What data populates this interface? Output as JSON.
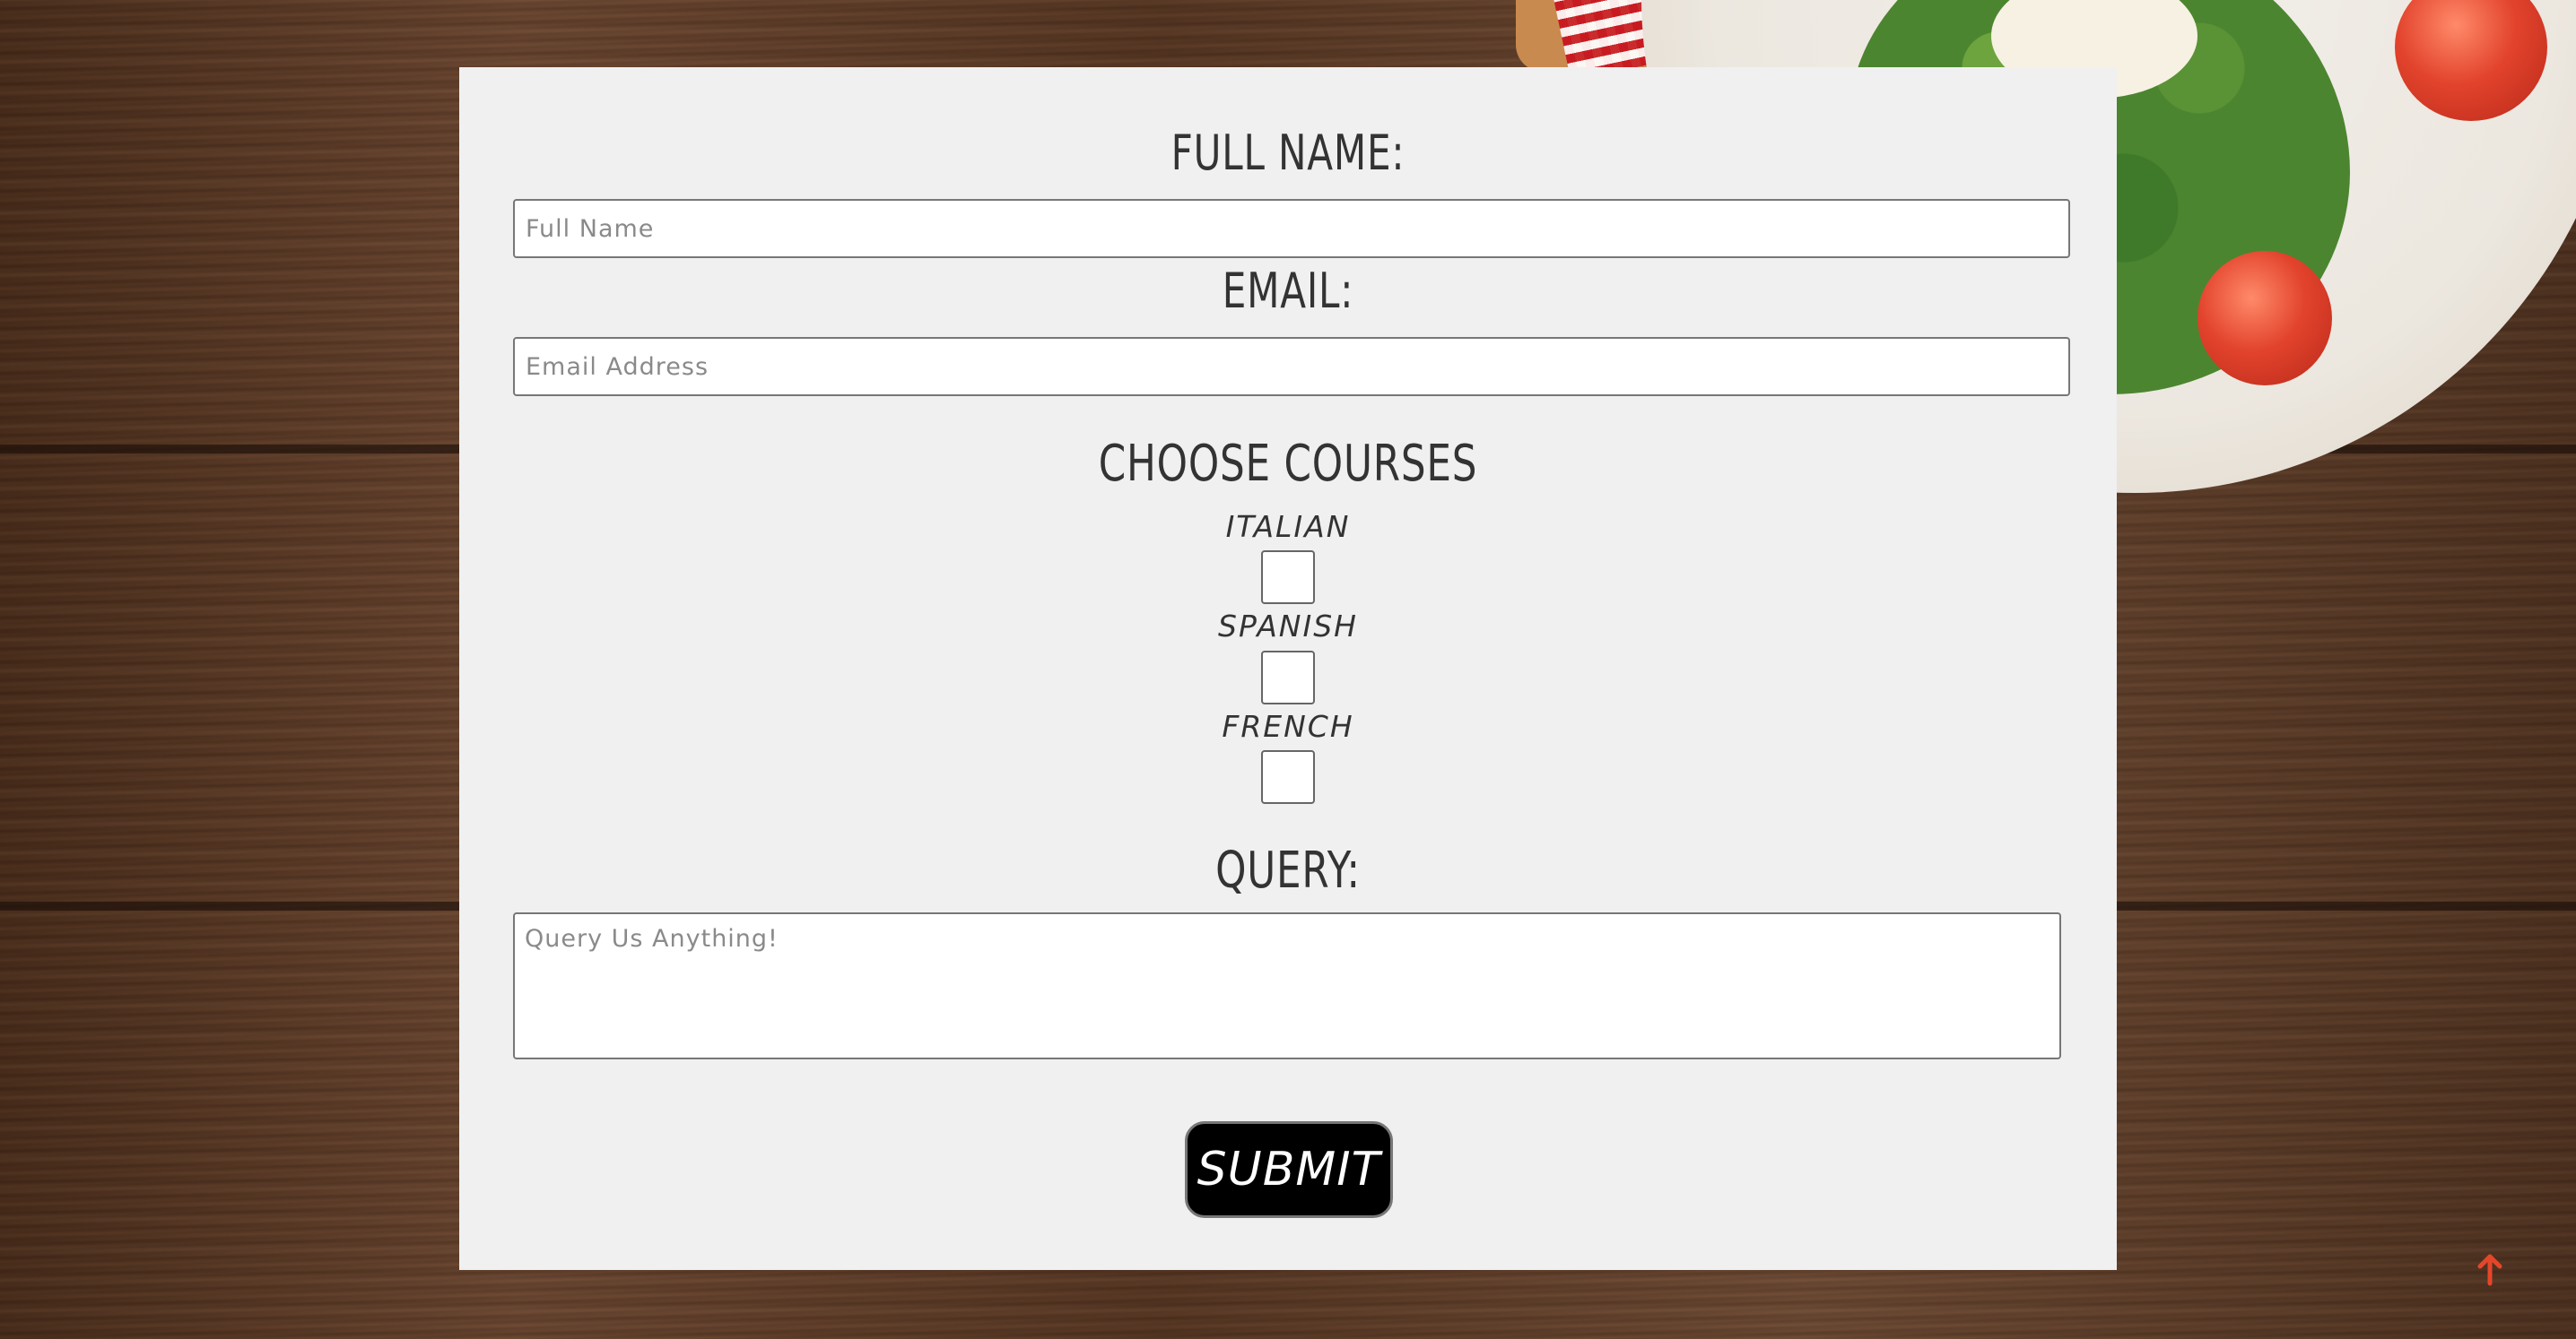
{
  "form": {
    "full_name": {
      "label": "FULL NAME:",
      "placeholder": "Full Name",
      "value": ""
    },
    "email": {
      "label": "EMAIL:",
      "placeholder": "Email Address",
      "value": ""
    },
    "courses": {
      "heading": "CHOOSE COURSES",
      "options": [
        {
          "label": "ITALIAN",
          "checked": false
        },
        {
          "label": "SPANISH",
          "checked": false
        },
        {
          "label": "FRENCH",
          "checked": false
        }
      ]
    },
    "query": {
      "label": "QUERY:",
      "placeholder": "Query Us Anything!",
      "value": ""
    },
    "submit_label": "SUBMIT"
  },
  "icons": {
    "scroll_top": "arrow-up-icon"
  },
  "colors": {
    "card_background": "#f0f0f0",
    "text": "#333333",
    "button_background": "#000000",
    "button_text": "#ffffff",
    "scroll_top_accent": "#e5462a"
  }
}
